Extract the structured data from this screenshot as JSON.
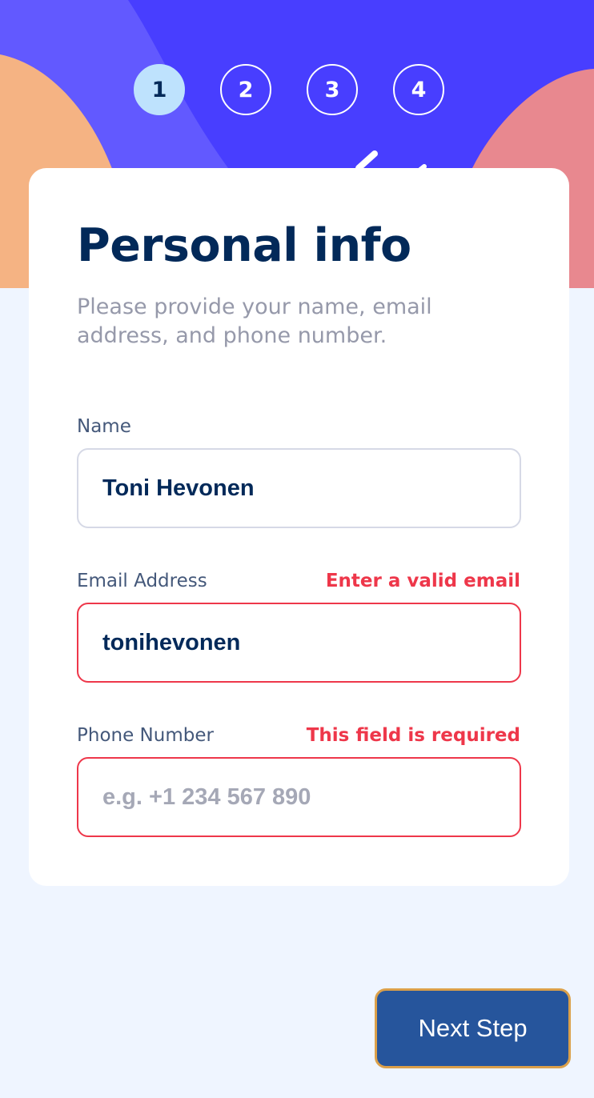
{
  "steps": [
    {
      "number": "1",
      "active": true
    },
    {
      "number": "2",
      "active": false
    },
    {
      "number": "3",
      "active": false
    },
    {
      "number": "4",
      "active": false
    }
  ],
  "form": {
    "title": "Personal info",
    "subtitle": "Please provide your name, email address, and phone number.",
    "name": {
      "label": "Name",
      "value": "Toni Hevonen",
      "placeholder": ""
    },
    "email": {
      "label": "Email Address",
      "error": "Enter a valid email",
      "value": "tonihevonen",
      "placeholder": ""
    },
    "phone": {
      "label": "Phone Number",
      "error": "This field is required",
      "value": "",
      "placeholder": "e.g. +1 234 567 890"
    }
  },
  "actions": {
    "next_label": "Next Step"
  },
  "colors": {
    "hero_background": "#483eff",
    "hero_light_band": "#6259ff",
    "hero_orange": "#ffaf7e",
    "hero_pink": "#f9818e",
    "active_step": "#bee2fd",
    "marine_blue": "#022959",
    "error_red": "#ee374a",
    "next_button": "#26559c",
    "page_background": "#eff5ff"
  }
}
